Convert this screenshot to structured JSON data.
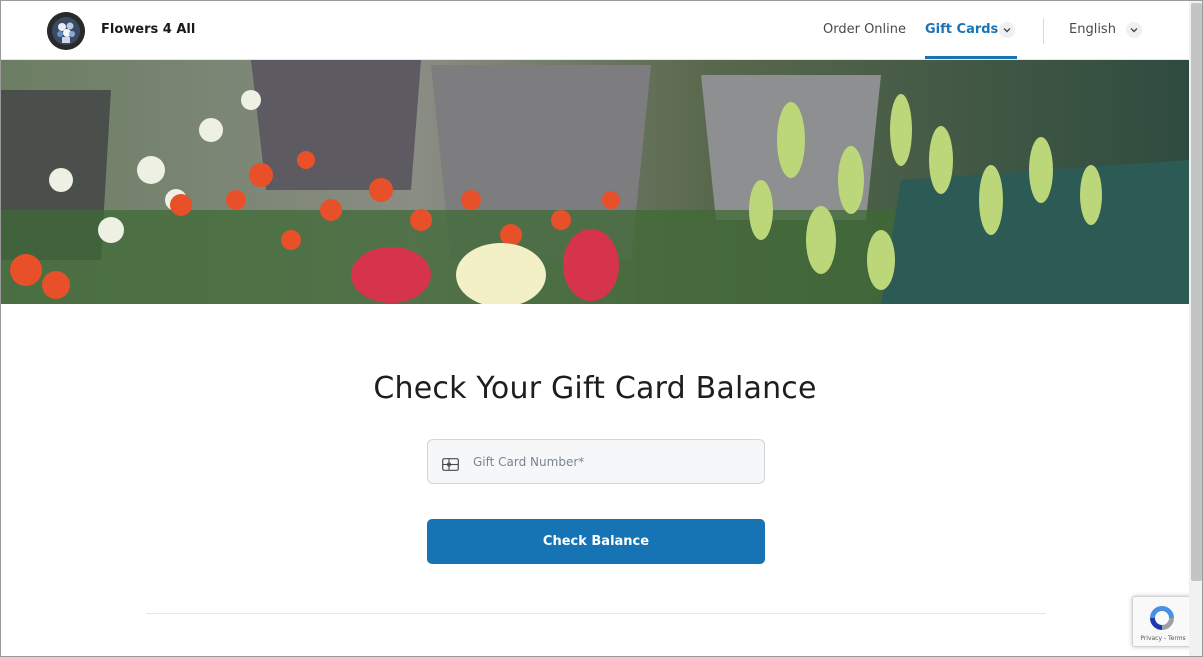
{
  "header": {
    "brand": "Flowers 4 All",
    "nav": {
      "order_online": "Order Online",
      "gift_cards": "Gift Cards",
      "language": "English"
    }
  },
  "hero": {
    "image": "flower-shop-hero"
  },
  "main": {
    "title": "Check Your Gift Card Balance",
    "gift_card_input": {
      "placeholder": "Gift Card Number*",
      "value": "",
      "icon": "gift-card-icon"
    },
    "check_button": "Check Balance"
  },
  "recaptcha": {
    "text": "Privacy - Terms"
  },
  "colors": {
    "accent": "#1673b4",
    "active_nav": "#1a73b5"
  }
}
